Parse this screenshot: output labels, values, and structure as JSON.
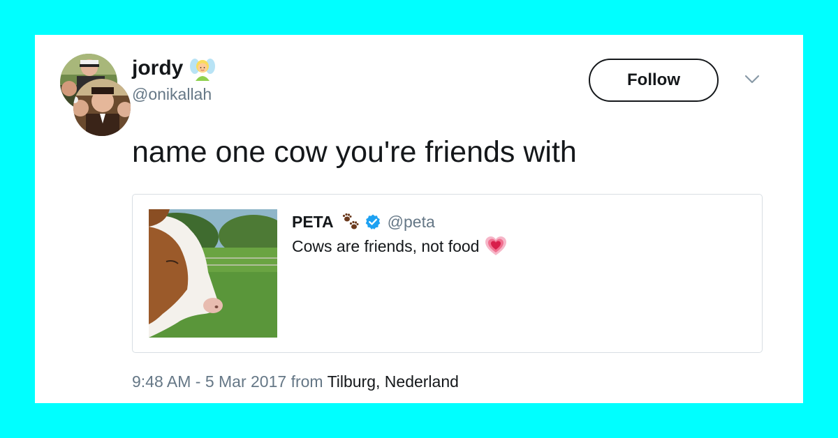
{
  "tweet": {
    "author": {
      "display_name": "jordy",
      "name_emoji": "fairy-emoji",
      "handle": "@onikallah",
      "avatar": "avatar-photo-of-people"
    },
    "follow_label": "Follow",
    "menu_icon": "chevron-down-icon",
    "text": "name one cow you're friends with",
    "quoted": {
      "display_name": "PETA",
      "name_emoji": "paw-prints-emoji",
      "verified": true,
      "handle": "@peta",
      "text": "Cows are friends, not food",
      "text_emoji": "growing-heart-emoji",
      "image": "cow-in-field-photo"
    },
    "timestamp": {
      "time_date": "9:48 AM - 5 Mar 2017",
      "from_word": "from",
      "location": "Tilburg, Nederland"
    }
  },
  "colors": {
    "background": "#00ffff",
    "card": "#ffffff",
    "text_primary": "#14171a",
    "text_secondary": "#657786",
    "verified": "#1da1f2",
    "quote_border": "#d8dee3"
  }
}
